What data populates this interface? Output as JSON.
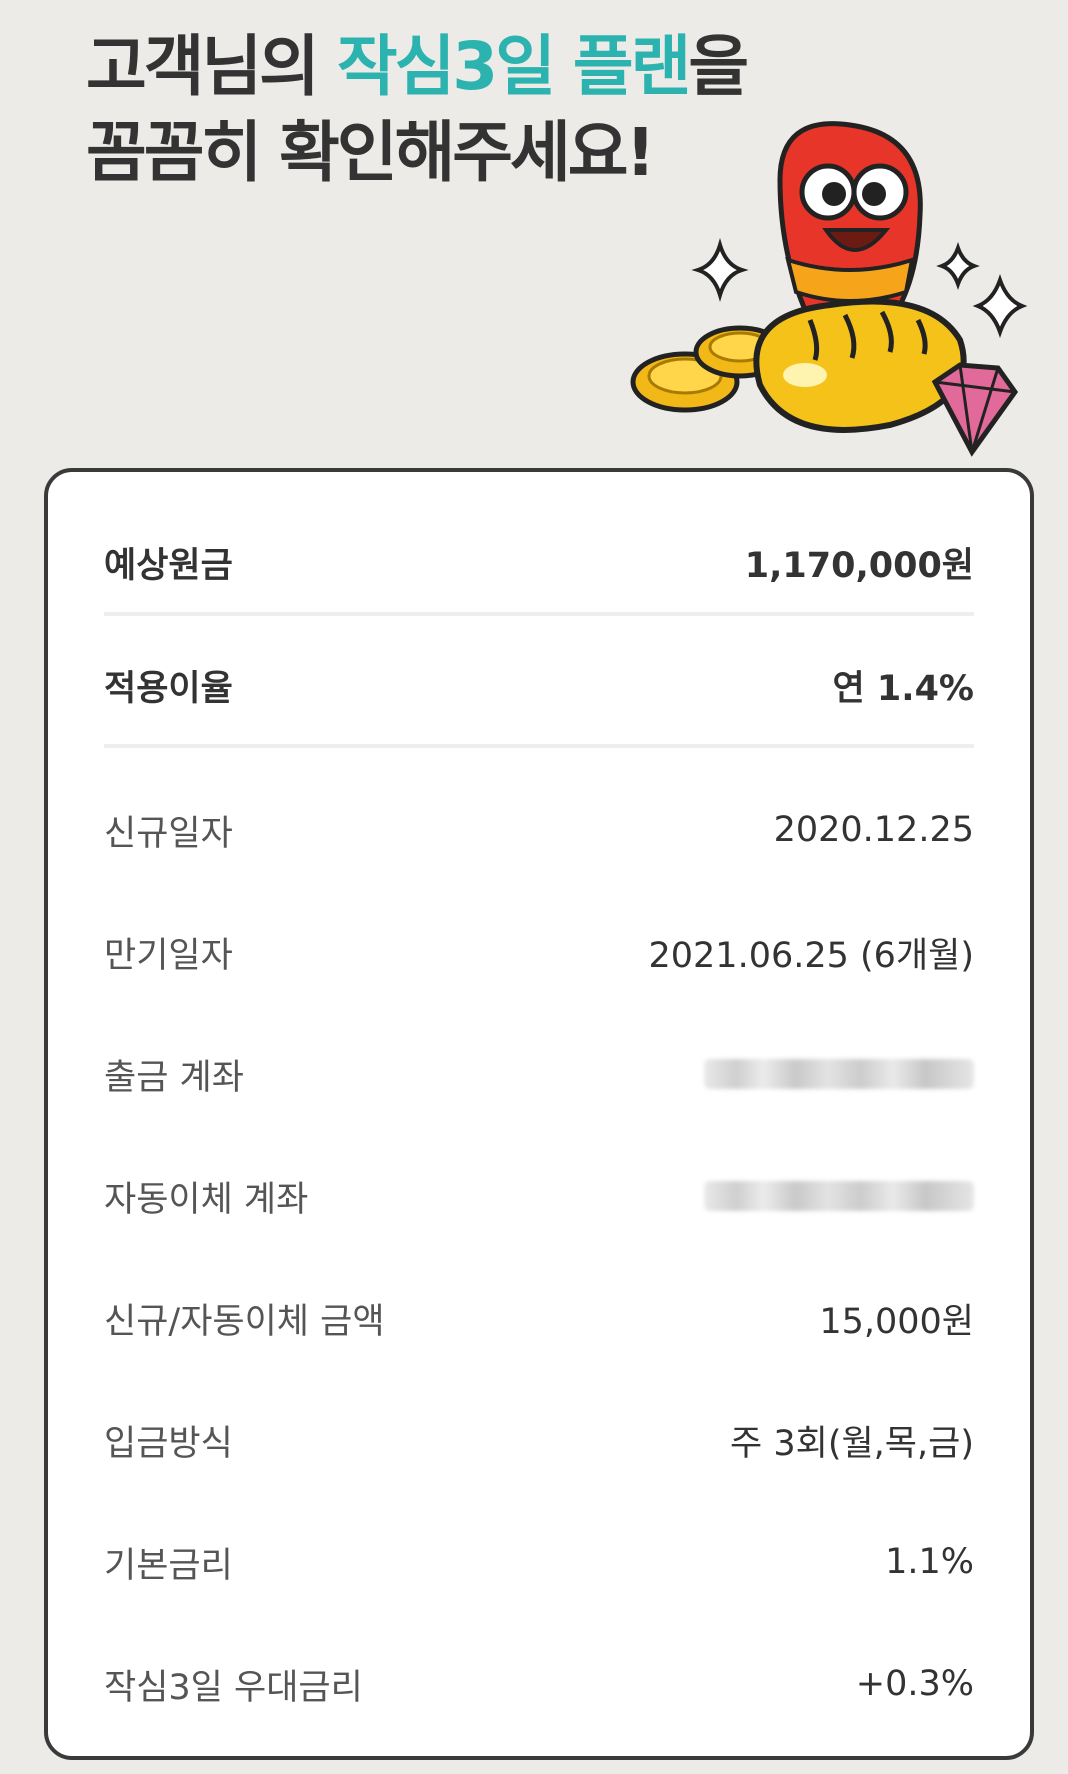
{
  "headline": {
    "line1_a": "고객님의 ",
    "line1_accent": "작심3일 플랜",
    "line1_b": "을",
    "line2": "꼼꼼히 확인해주세요!"
  },
  "colors": {
    "accent": "#2cb3b0",
    "background": "#ecebe7",
    "card_border": "#3a3a3a"
  },
  "summary": {
    "expected_principal": {
      "label": "예상원금",
      "value": "1,170,000원"
    },
    "applied_rate": {
      "label": "적용이율",
      "value": "연 1.4%"
    }
  },
  "details": [
    {
      "label": "신규일자",
      "value": "2020.12.25"
    },
    {
      "label": "만기일자",
      "value": "2021.06.25 (6개월)"
    },
    {
      "label": "출금 계좌",
      "value": ""
    },
    {
      "label": "자동이체 계좌",
      "value": ""
    },
    {
      "label": "신규/자동이체 금액",
      "value": "15,000원"
    },
    {
      "label": "입금방식",
      "value": "주 3회(월,목,금)"
    },
    {
      "label": "기본금리",
      "value": "1.1%"
    },
    {
      "label": "작심3일 우대금리",
      "value": "+0.3%"
    }
  ],
  "icons": [
    "mascot-illustration",
    "sparkle-icon",
    "coin-icon",
    "bread-icon",
    "gem-icon"
  ]
}
